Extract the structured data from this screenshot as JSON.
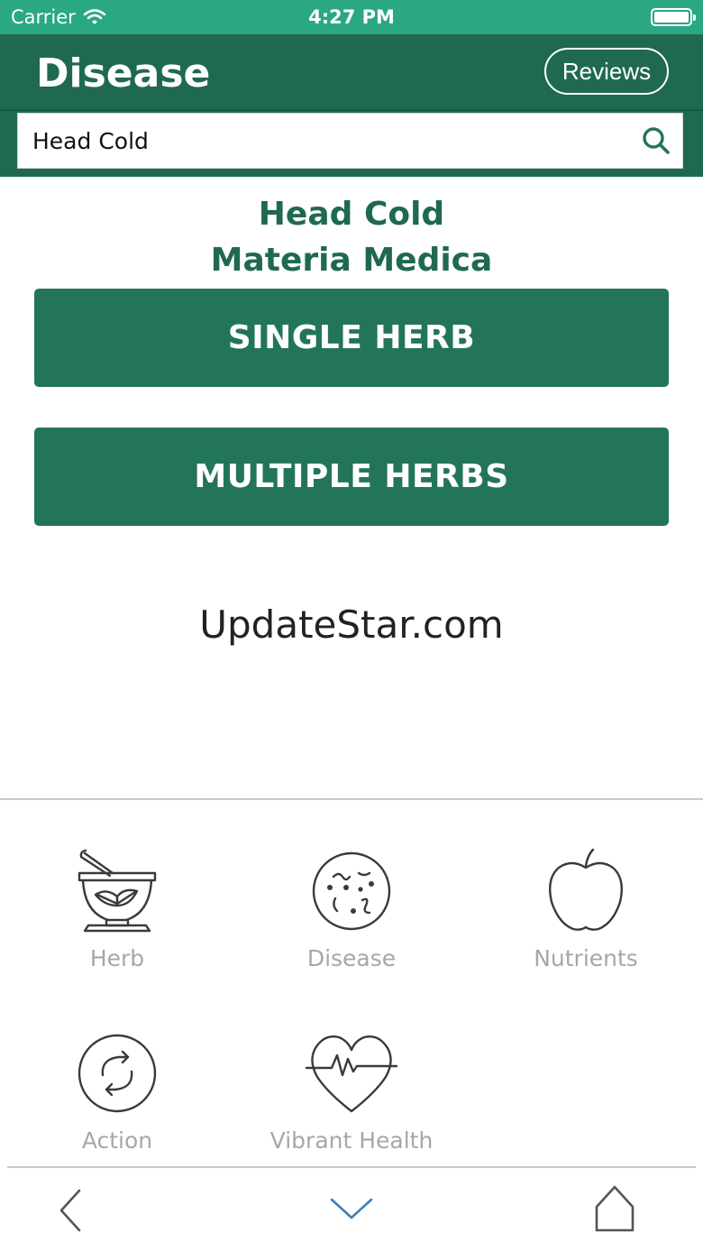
{
  "status_bar": {
    "carrier": "Carrier",
    "time": "4:27 PM"
  },
  "header": {
    "title": "Disease",
    "reviews_label": "Reviews",
    "search_value": "Head Cold"
  },
  "result": {
    "title_line1": "Head Cold",
    "title_line2": "Materia Medica"
  },
  "buttons": {
    "single_herb": "SINGLE HERB",
    "multiple_herbs": "MULTIPLE HERBS"
  },
  "watermark": "UpdateStar.com",
  "categories": [
    {
      "label": "Herb",
      "icon": "mortar-pestle-icon"
    },
    {
      "label": "Disease",
      "icon": "microbe-icon"
    },
    {
      "label": "Nutrients",
      "icon": "apple-icon"
    },
    {
      "label": "Action",
      "icon": "cycle-arrows-icon"
    },
    {
      "label": "Vibrant Health",
      "icon": "heartbeat-icon"
    }
  ],
  "nav": {
    "back": "chevron-left-icon",
    "down": "chevron-down-icon",
    "home": "home-icon"
  },
  "colors": {
    "status_bar": "#2aa783",
    "header": "#1f6a4f",
    "button": "#237558",
    "accent_text": "#1f6a4f",
    "label_gray": "#a7a7a7",
    "nav_accent": "#3f7fb6"
  }
}
